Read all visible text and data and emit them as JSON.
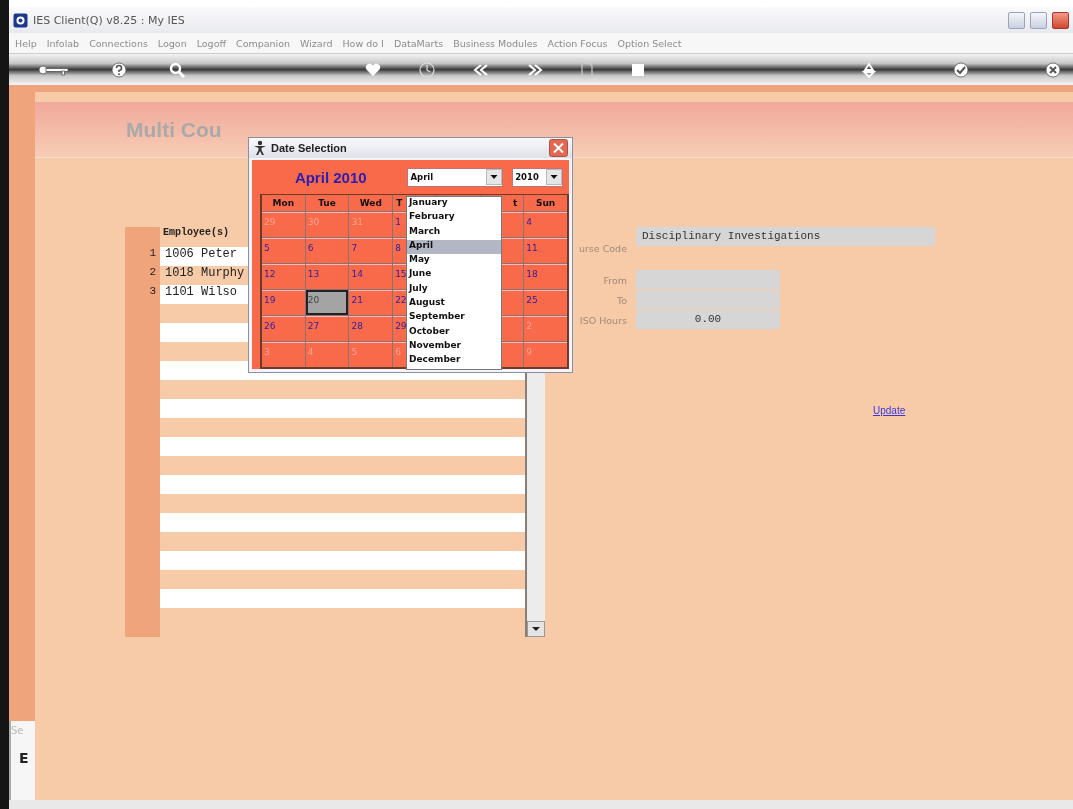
{
  "window": {
    "title": "IES Client(Q) v8.25 : My IES"
  },
  "menu": [
    "Help",
    "Infolab",
    "Connections",
    "Logon",
    "Logoff",
    "Companion",
    "Wizard",
    "How do I",
    "DataMarts",
    "Business Modules",
    "Action Focus",
    "Option Select"
  ],
  "page": {
    "heading": "Multi Cou"
  },
  "employees": {
    "header": "Employee(s)",
    "rows": [
      {
        "number": "1",
        "text": "1006 Peter"
      },
      {
        "number": "2",
        "text": "1018 Murphy"
      },
      {
        "number": "3",
        "text": "1101 Wilso"
      }
    ]
  },
  "form": {
    "fields": [
      {
        "kind": "wide",
        "label": "urse Code",
        "value": "Disciplinary Investigations"
      },
      {
        "kind": "date",
        "label": "From"
      },
      {
        "kind": "date",
        "label": "To"
      },
      {
        "kind": "number",
        "label": "ISO Hours",
        "value": "0.00"
      }
    ]
  },
  "update_link": "Update",
  "side_panel": {
    "tab": "Se",
    "letter": "E"
  },
  "date_dialog": {
    "title": "Date Selection",
    "month_year": "April 2010",
    "month_select": "April",
    "year_select": "2010",
    "weekdays": [
      "Mon",
      "Tue",
      "Wed",
      "T",
      "t",
      "Sun"
    ],
    "weeks": [
      [
        {
          "day": "29",
          "other_month": true,
          "selected": false
        },
        {
          "day": "30",
          "other_month": true,
          "selected": false
        },
        {
          "day": "31",
          "other_month": true,
          "selected": false
        },
        {
          "day": "1",
          "other_month": false,
          "selected": false
        },
        {
          "day": "4",
          "other_month": false,
          "selected": false
        }
      ],
      [
        {
          "day": "5",
          "other_month": false,
          "selected": false
        },
        {
          "day": "6",
          "other_month": false,
          "selected": false
        },
        {
          "day": "7",
          "other_month": false,
          "selected": false
        },
        {
          "day": "8",
          "other_month": false,
          "selected": false
        },
        {
          "day": "11",
          "other_month": false,
          "selected": false
        }
      ],
      [
        {
          "day": "12",
          "other_month": false,
          "selected": false
        },
        {
          "day": "13",
          "other_month": false,
          "selected": false
        },
        {
          "day": "14",
          "other_month": false,
          "selected": false
        },
        {
          "day": "15",
          "other_month": false,
          "selected": false
        },
        {
          "day": "18",
          "other_month": false,
          "selected": false
        }
      ],
      [
        {
          "day": "19",
          "other_month": false,
          "selected": false
        },
        {
          "day": "20",
          "other_month": false,
          "selected": true
        },
        {
          "day": "21",
          "other_month": false,
          "selected": false
        },
        {
          "day": "22",
          "other_month": false,
          "selected": false
        },
        {
          "day": "25",
          "other_month": false,
          "selected": false
        }
      ],
      [
        {
          "day": "26",
          "other_month": false,
          "selected": false
        },
        {
          "day": "27",
          "other_month": false,
          "selected": false
        },
        {
          "day": "28",
          "other_month": false,
          "selected": false
        },
        {
          "day": "29",
          "other_month": false,
          "selected": false
        },
        {
          "day": "2",
          "other_month": true,
          "selected": false
        }
      ],
      [
        {
          "day": "3",
          "other_month": true,
          "selected": false
        },
        {
          "day": "4",
          "other_month": true,
          "selected": false
        },
        {
          "day": "5",
          "other_month": true,
          "selected": false
        },
        {
          "day": "6",
          "other_month": true,
          "selected": false
        },
        {
          "day": "9",
          "other_month": true,
          "selected": false
        }
      ]
    ],
    "month_list": [
      {
        "label": "January",
        "selected": false
      },
      {
        "label": "February",
        "selected": false
      },
      {
        "label": "March",
        "selected": false
      },
      {
        "label": "April",
        "selected": true
      },
      {
        "label": "May",
        "selected": false
      },
      {
        "label": "June",
        "selected": false
      },
      {
        "label": "July",
        "selected": false
      },
      {
        "label": "August",
        "selected": false
      },
      {
        "label": "September",
        "selected": false
      },
      {
        "label": "October",
        "selected": false
      },
      {
        "label": "November",
        "selected": false
      },
      {
        "label": "December",
        "selected": false
      }
    ]
  }
}
